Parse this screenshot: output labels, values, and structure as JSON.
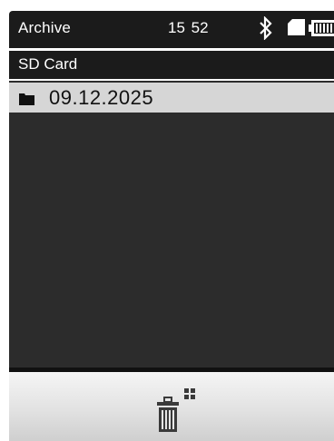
{
  "status_bar": {
    "title": "Archive",
    "time": "15 52",
    "icons": [
      "bluetooth-icon",
      "sd-card-icon",
      "battery-icon"
    ]
  },
  "location": {
    "label": "SD Card"
  },
  "list": {
    "items": [
      {
        "label": "09.12.2025",
        "icon": "folder-icon",
        "selected": true
      }
    ]
  },
  "toolbar": {
    "buttons": [
      {
        "icon": "trash-all-icon"
      }
    ]
  },
  "colors": {
    "bar_background": "#1b1b1b",
    "content_background": "#2c2c2c",
    "selected_row": "#d6d6d6",
    "toolbar_light": "#f5f5f5",
    "toolbar_dark": "#cfcfcf"
  }
}
